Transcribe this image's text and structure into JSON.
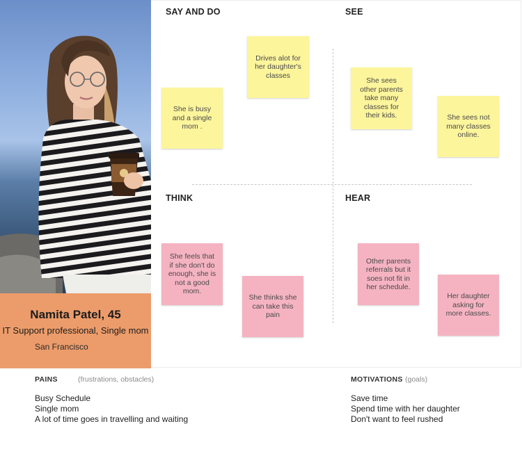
{
  "persona": {
    "name": "Namita Patel, 45",
    "role": "IT Support professional, Single mom",
    "location": "San Francisco"
  },
  "quadrants": {
    "say_and_do": {
      "title": "SAY AND DO",
      "notes": [
        "She is busy and a single mom .",
        "Drives alot for her daughter's classes"
      ]
    },
    "see": {
      "title": "SEE",
      "notes": [
        "She sees other parents take many classes for their kids.",
        "She sees not many classes online."
      ]
    },
    "think": {
      "title": "THINK",
      "notes": [
        "She feels that if she don't do enough, she is not a good mom.",
        "She thinks she can take this pain"
      ]
    },
    "hear": {
      "title": "HEAR",
      "notes": [
        "Other parents referrals but it soes not fit in her schedule.",
        "Her daughter asking for more classes."
      ]
    }
  },
  "pains": {
    "title": "PAINS",
    "subtitle": "(frustrations, obstacles)",
    "items": [
      "Busy Schedule",
      "Single mom",
      "A lot of time goes in travelling and waiting"
    ]
  },
  "motivations": {
    "title": "MOTIVATIONS",
    "subtitle": "(goals)",
    "items": [
      "Save time",
      "Spend time with her daughter",
      "Don't want to feel rushed"
    ]
  },
  "colors": {
    "persona_card": "#ec9c6a",
    "sticky_yellow": "#fdf59c",
    "sticky_pink": "#f5b3c2"
  }
}
